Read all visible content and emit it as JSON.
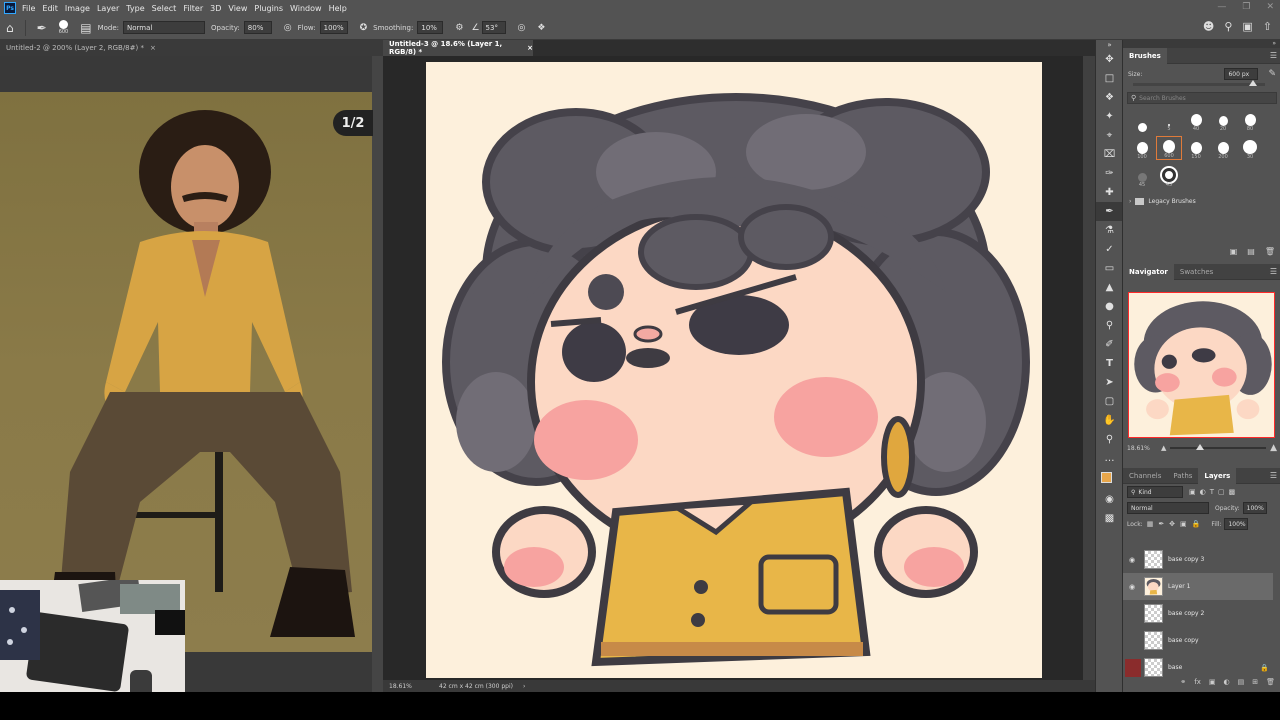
{
  "app": {
    "logo": "Ps"
  },
  "menu": [
    "File",
    "Edit",
    "Image",
    "Layer",
    "Type",
    "Select",
    "Filter",
    "3D",
    "View",
    "Plugins",
    "Window",
    "Help"
  ],
  "options_bar": {
    "brush_size": "600",
    "mode_label": "Mode:",
    "mode_value": "Normal",
    "opacity_label": "Opacity:",
    "opacity_value": "80%",
    "flow_label": "Flow:",
    "flow_value": "100%",
    "smoothing_label": "Smoothing:",
    "smoothing_value": "10%",
    "angle_value": "53°"
  },
  "documents": {
    "left_tab": "Untitled-2 @ 200% (Layer 2, RGB/8#) *",
    "center_tab": "Untitled-3 @ 18.6% (Layer 1, RGB/8) *",
    "page_indicator": "1/2"
  },
  "status": {
    "zoom": "18.61%",
    "doc_info": "42 cm x 42 cm (300 ppi)"
  },
  "brushes_panel": {
    "title": "Brushes",
    "size_label": "Size:",
    "size_value": "600 px",
    "search_placeholder": "Search Brushes",
    "brush_sizes": [
      "",
      "5",
      "40",
      "20",
      "80",
      "100",
      "600",
      "150",
      "200",
      "30",
      "45",
      "45"
    ],
    "folder": "Legacy Brushes"
  },
  "navigator_panel": {
    "tabs": [
      "Navigator",
      "Swatches"
    ],
    "zoom": "18.61%"
  },
  "layers_panel": {
    "tabs": [
      "Channels",
      "Paths",
      "Layers"
    ],
    "filter": "Kind",
    "blend_mode": "Normal",
    "opacity_label": "Opacity:",
    "opacity_value": "100%",
    "lock_label": "Lock:",
    "fill_label": "Fill:",
    "fill_value": "100%",
    "layers": [
      "base copy 3",
      "Layer 1",
      "base copy 2",
      "base copy",
      "base"
    ]
  },
  "colors": {
    "foreground": "#e8a64a",
    "background": "#ffffff",
    "accent": "#31a8ff"
  },
  "icons": [
    "home-icon",
    "brush-icon",
    "search-icon",
    "gear-icon",
    "eye-icon",
    "lock-icon"
  ]
}
